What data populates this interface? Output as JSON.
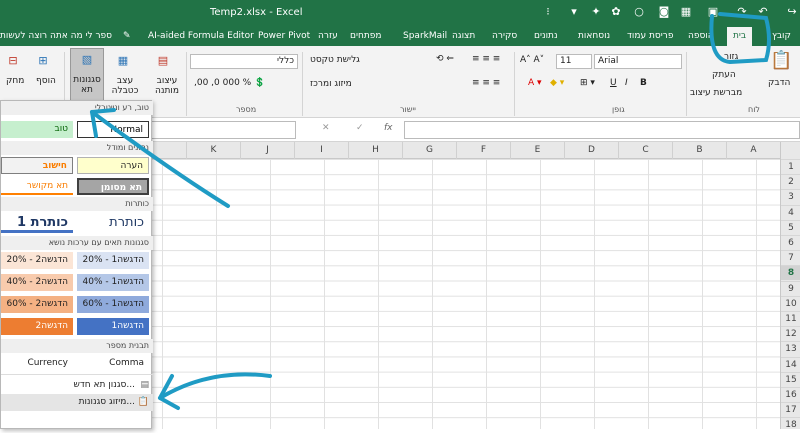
{
  "window": {
    "title": "Temp2.xlsx - Excel",
    "tell_me": "ספר לי מה אתה רוצה לעשות"
  },
  "ribbon_tabs": [
    "קובץ",
    "בית",
    "הוספה",
    "פריסת עמוד",
    "נוסחאות",
    "נתונים",
    "סקירה",
    "תצוגה",
    "SparkMail",
    "מפתחים",
    "עזרה",
    "Power Pivot",
    "AI-aided Formula Editor"
  ],
  "active_tab": "בית",
  "clipboard": {
    "paste": "הדבק",
    "cut": "גזור",
    "copy": "העתק",
    "format_painter": "מברשת עיצוב",
    "group": "לוח"
  },
  "font": {
    "name": "Arial",
    "size": "11",
    "group": "גופן"
  },
  "alignment": {
    "wrap_text": "גלישת טקסט",
    "merge_center": "מיזוג ומרכז",
    "group": "יישור"
  },
  "number": {
    "format": "כללי",
    "group": "מספר"
  },
  "styles": {
    "conditional": "עיצוב מותנה",
    "format_table": "עצב כטבלה",
    "cell_styles": "סגנונות תא"
  },
  "cells": {
    "insert": "הוסף",
    "delete": "מחק"
  },
  "columns": [
    "A",
    "B",
    "C",
    "D",
    "E",
    "F",
    "G",
    "H",
    "I",
    "J",
    "K"
  ],
  "rows": [
    "1",
    "2",
    "3",
    "4",
    "5",
    "6",
    "7",
    "8",
    "9",
    "10",
    "11",
    "12",
    "13",
    "14",
    "15",
    "16",
    "17",
    "18"
  ],
  "selected_row": "8",
  "cell_styles_panel": {
    "section_good_bad": "טוב, רע ונייטרלי",
    "normal": "Normal",
    "good": "טוב",
    "section_data": "נתונים ומודל",
    "note": "הערה",
    "important": "חישוב",
    "check_cell": "תא מסומן",
    "linked_cell": "תא מקושר",
    "section_titles": "כותרות",
    "title": "כותרת",
    "heading1": "כותרת 1",
    "section_themed": "סגנונות תאים עם ערכות נושא",
    "accent1_20": "הדגשה1 - 20%",
    "accent2_20": "הדגשה2 - 20%",
    "accent1_40": "הדגשה1 - 40%",
    "accent2_40": "הדגשה2 - 40%",
    "accent1_60": "הדגשה1 - 60%",
    "accent2_60": "הדגשה2 - 60%",
    "accent1": "הדגשה1",
    "accent2": "הדגשה2",
    "section_number": "תבנית מספר",
    "currency": "Currency",
    "comma": "Comma",
    "new_style": "סגנון תא חדש...",
    "merge_styles": "מיזוג סגנונות..."
  },
  "colors": {
    "excel_green": "#217346",
    "annotation": "#1f9bc4",
    "accent1_20": "#dae3f3",
    "accent1_40": "#b4c7e7",
    "accent1_60": "#8faadc",
    "accent1": "#4472c4",
    "accent2_20": "#fbe5d6",
    "accent2_40": "#f8cbad",
    "accent2_60": "#f4b183",
    "accent2": "#ed7d31"
  }
}
